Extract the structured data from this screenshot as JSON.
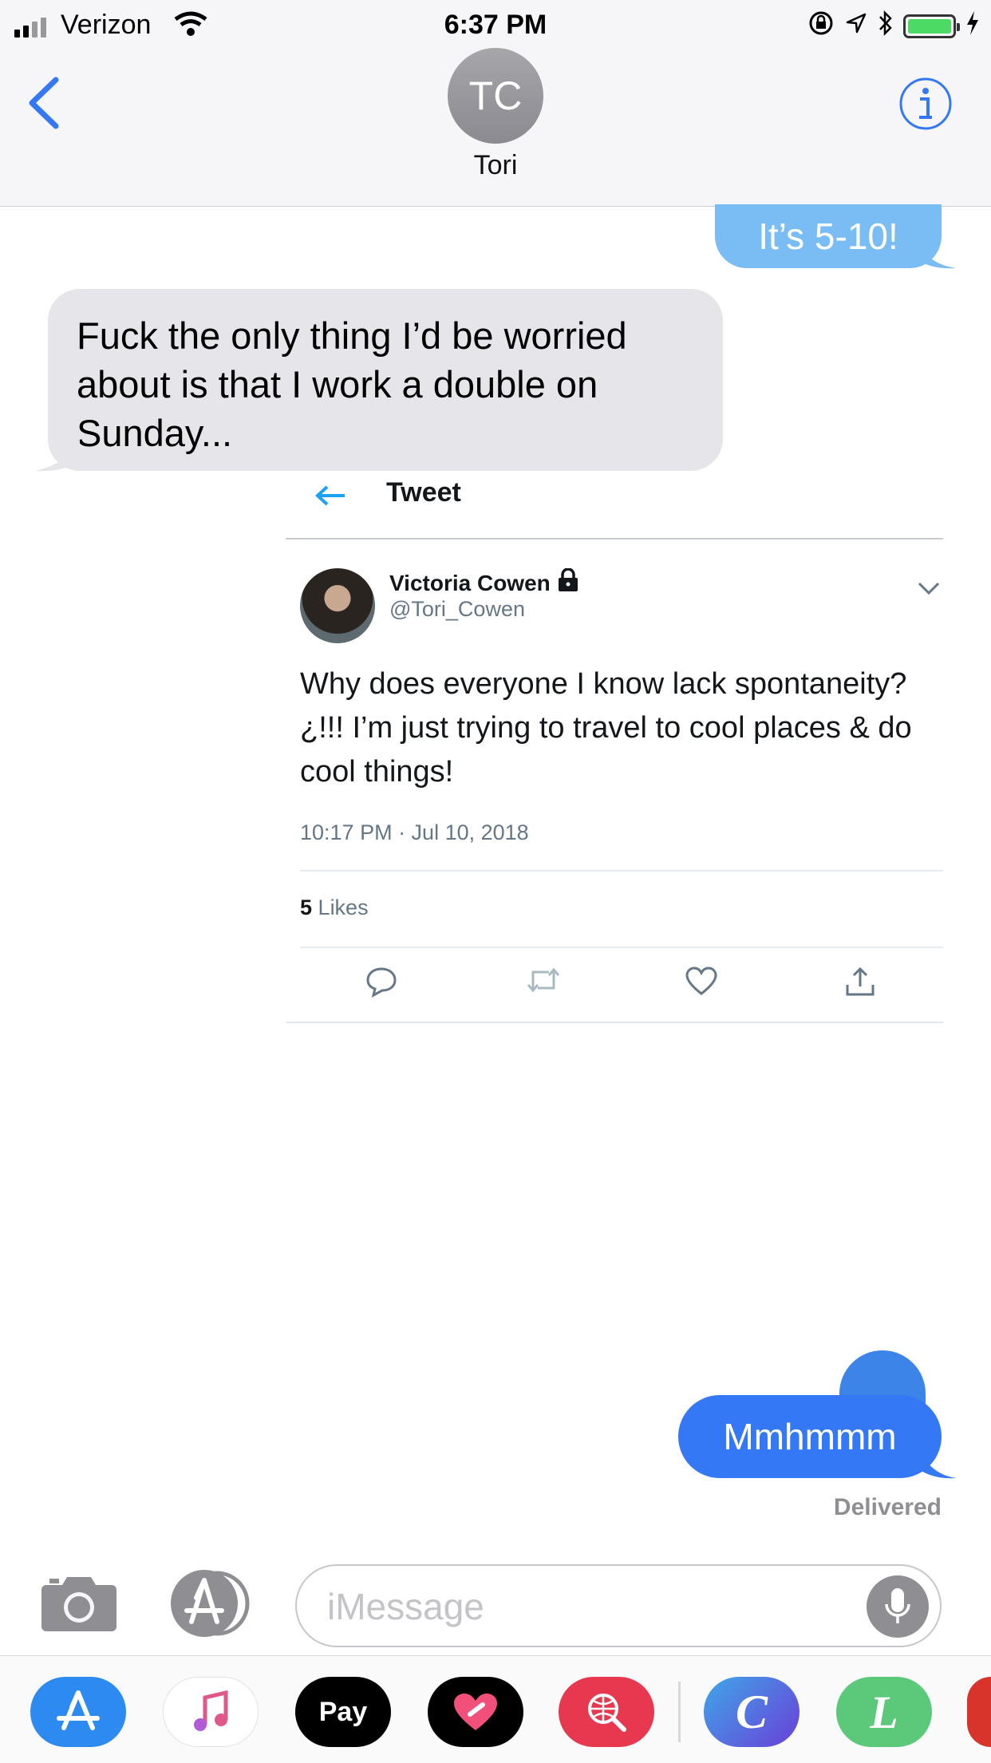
{
  "status_bar": {
    "carrier": "Verizon",
    "time": "6:37 PM",
    "battery_color": "#4cd964"
  },
  "nav": {
    "back_icon": "chevron-left-icon",
    "avatar_initials": "TC",
    "contact_name": "Tori",
    "info_icon": "info-icon",
    "accent": "#3478f6"
  },
  "messages": {
    "sent_top": "It’s 5-10!",
    "received": "Fuck the only thing I’d be worried about is that I work a double on Sunday...",
    "sent_bottom": "Mmhmmm",
    "delivered": "Delivered"
  },
  "tweet": {
    "header_title": "Tweet",
    "author_name": "Victoria Cowen",
    "handle": "@Tori_Cowen",
    "text": "Why does everyone I know lack spontaneity?¿!!! I’m just trying to travel to cool places & do cool things!",
    "timestamp": "10:17 PM · Jul 10, 2018",
    "likes_count": "5",
    "likes_label": "Likes"
  },
  "composer": {
    "placeholder": "iMessage"
  },
  "app_drawer": {
    "apps": [
      {
        "name": "App Store",
        "icon": "app-store-icon",
        "color": "#2d8af0"
      },
      {
        "name": "Music",
        "icon": "music-icon",
        "color": "#ffffff"
      },
      {
        "name": "Apple Pay",
        "icon": "apple-pay-icon",
        "label": "Pay",
        "color": "#000000"
      },
      {
        "name": "Digital Touch",
        "icon": "heart-icon",
        "color": "#000000"
      },
      {
        "name": "Search",
        "icon": "globe-search-icon",
        "color": "#e8384f"
      },
      {
        "name": "C app",
        "icon": "c-icon",
        "label": "C",
        "color": "#4a5fe0"
      },
      {
        "name": "L app",
        "icon": "l-icon",
        "label": "L",
        "color": "#5cc87a"
      },
      {
        "name": "partial app",
        "icon": "partial-app-icon",
        "color": "#d9342b"
      }
    ]
  }
}
